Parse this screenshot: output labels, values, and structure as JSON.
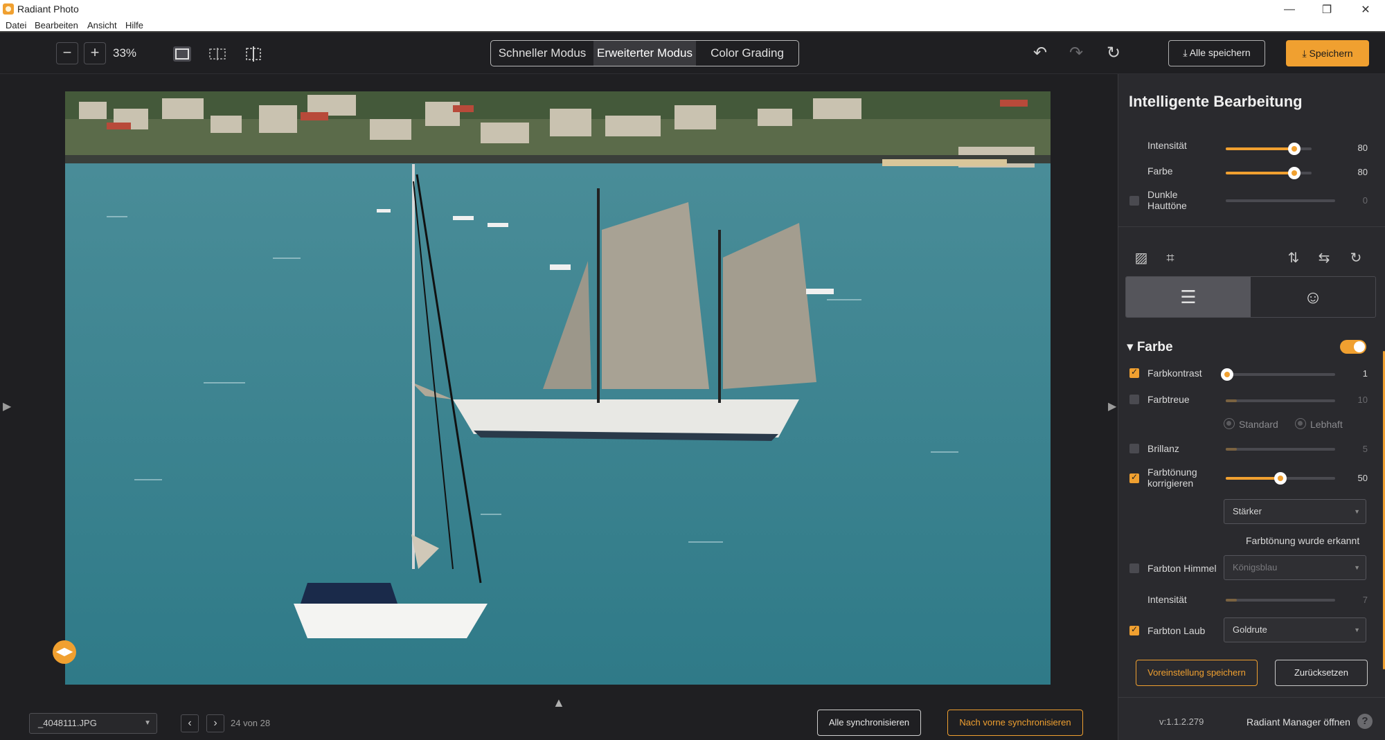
{
  "app": {
    "title": "Radiant Photo"
  },
  "menu": [
    "Datei",
    "Bearbeiten",
    "Ansicht",
    "Hilfe"
  ],
  "toolbar": {
    "zoom": "33%",
    "modes": [
      "Schneller Modus",
      "Erweiterter Modus",
      "Color Grading"
    ],
    "active_mode": "Erweiterter Modus",
    "save_all": "Alle speichern",
    "save": "Speichern"
  },
  "footer": {
    "file": "_4048111.JPG",
    "page_count": "24 von 28",
    "sync_all": "Alle synchronisieren",
    "sync_forward": "Nach vorne synchronisieren"
  },
  "panel": {
    "title": "Intelligente Bearbeitung",
    "smart": [
      {
        "label": "Intensität",
        "value": "80",
        "level": 0.8
      },
      {
        "label": "Farbe",
        "value": "80",
        "level": 0.8
      },
      {
        "label": "Dunkle Hauttöne",
        "value": "0",
        "level": 0.0
      }
    ],
    "section": "Farbe",
    "farbkontrast": {
      "label": "Farbkontrast",
      "value": "1",
      "level": 0.01,
      "checked": true
    },
    "farbtreue": {
      "label": "Farbtreue",
      "value": "10",
      "level": 0.1,
      "checked": false
    },
    "radios": [
      "Standard",
      "Lebhaft"
    ],
    "brillanz": {
      "label": "Brillanz",
      "value": "5",
      "level": 0.1,
      "checked": false
    },
    "farbtoenung": {
      "label": "Farbtönung korrigieren",
      "value": "50",
      "level": 0.5,
      "checked": true
    },
    "staerke": "Stärker",
    "erkannt": "Farbtönung wurde erkannt",
    "himmel": {
      "label": "Farbton Himmel",
      "option": "Königsblau",
      "checked": false
    },
    "intensitaet2": {
      "label": "Intensität",
      "value": "7",
      "level": 0.1
    },
    "laub": {
      "label": "Farbton Laub",
      "option": "Goldrute",
      "checked": true
    },
    "save_preset": "Voreinstellung speichern",
    "reset": "Zurücksetzen",
    "version": "v:1.1.2.279",
    "manager": "Radiant Manager öffnen"
  },
  "colors": {
    "accent": "#f0a030",
    "bg": "#1f1f22",
    "panel": "#2a2a2e"
  }
}
